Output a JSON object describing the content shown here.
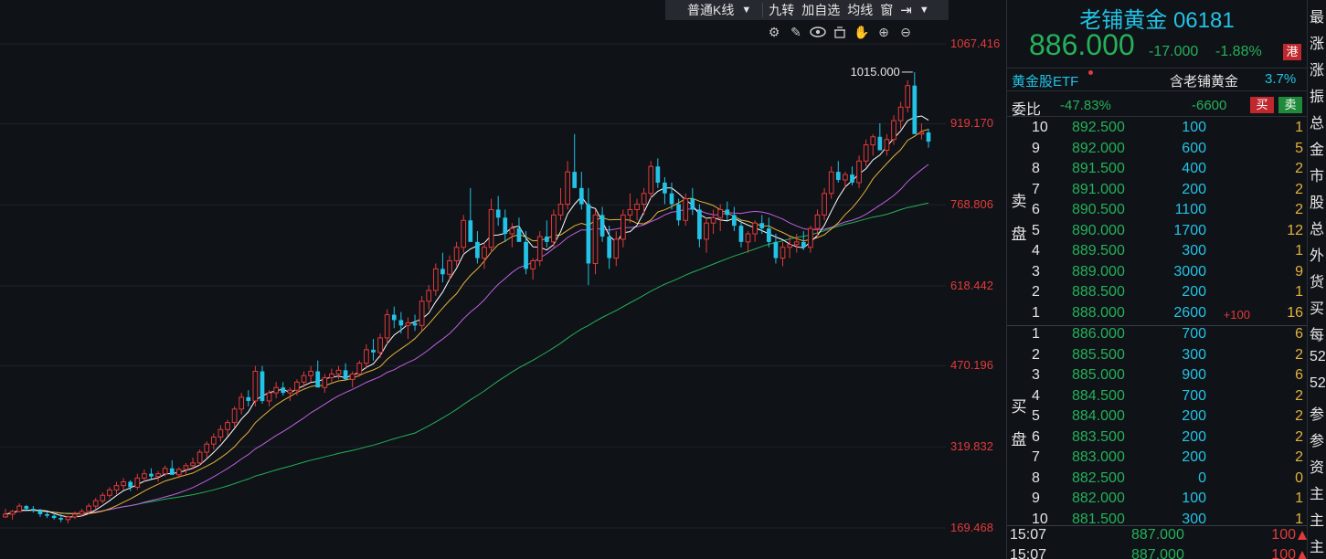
{
  "toolbar": {
    "chart_type": "普通K线",
    "items": [
      "九转",
      "加自选",
      "均线",
      "窗"
    ]
  },
  "chart_icons": [
    "settings-icon",
    "pen-icon",
    "eye-icon",
    "basket-icon",
    "hand-icon",
    "zoom-in-icon",
    "zoom-out-icon"
  ],
  "chart_data": {
    "type": "candlestick",
    "y_ticks": [
      "1067.416",
      "919.170",
      "768.806",
      "618.442",
      "470.196",
      "319.832",
      "169.468"
    ],
    "peak_label": "1015.000",
    "colors": {
      "up": "#e23b3b",
      "down": "#22c3e6",
      "ma5": "#ffffff",
      "ma10": "#e6b23b",
      "ma20": "#c060e0",
      "ma60": "#25b15a"
    },
    "candles": [
      [
        190,
        205,
        188,
        195
      ],
      [
        195,
        203,
        185,
        200
      ],
      [
        200,
        215,
        198,
        210
      ],
      [
        210,
        212,
        200,
        205
      ],
      [
        205,
        210,
        198,
        202
      ],
      [
        202,
        205,
        190,
        195
      ],
      [
        195,
        200,
        188,
        192
      ],
      [
        192,
        198,
        185,
        188
      ],
      [
        188,
        195,
        180,
        185
      ],
      [
        185,
        192,
        178,
        190
      ],
      [
        190,
        200,
        186,
        195
      ],
      [
        195,
        205,
        190,
        200
      ],
      [
        200,
        215,
        195,
        210
      ],
      [
        210,
        225,
        205,
        220
      ],
      [
        220,
        235,
        215,
        230
      ],
      [
        230,
        245,
        225,
        240
      ],
      [
        240,
        255,
        232,
        248
      ],
      [
        248,
        262,
        240,
        255
      ],
      [
        255,
        258,
        238,
        245
      ],
      [
        245,
        270,
        240,
        262
      ],
      [
        262,
        278,
        255,
        270
      ],
      [
        270,
        280,
        260,
        265
      ],
      [
        265,
        275,
        255,
        270
      ],
      [
        270,
        285,
        265,
        280
      ],
      [
        280,
        295,
        270,
        268
      ],
      [
        268,
        282,
        262,
        278
      ],
      [
        278,
        290,
        270,
        285
      ],
      [
        285,
        300,
        278,
        290
      ],
      [
        290,
        315,
        285,
        310
      ],
      [
        310,
        330,
        300,
        325
      ],
      [
        325,
        345,
        315,
        338
      ],
      [
        338,
        360,
        330,
        352
      ],
      [
        352,
        370,
        340,
        365
      ],
      [
        365,
        395,
        355,
        390
      ],
      [
        390,
        420,
        380,
        412
      ],
      [
        412,
        425,
        395,
        405
      ],
      [
        405,
        470,
        395,
        460
      ],
      [
        460,
        470,
        400,
        405
      ],
      [
        405,
        425,
        395,
        420
      ],
      [
        420,
        440,
        410,
        430
      ],
      [
        430,
        440,
        415,
        420
      ],
      [
        420,
        430,
        405,
        425
      ],
      [
        425,
        445,
        415,
        440
      ],
      [
        440,
        460,
        430,
        452
      ],
      [
        452,
        470,
        440,
        460
      ],
      [
        460,
        480,
        445,
        430
      ],
      [
        430,
        455,
        420,
        448
      ],
      [
        448,
        465,
        440,
        455
      ],
      [
        455,
        470,
        445,
        462
      ],
      [
        462,
        475,
        450,
        445
      ],
      [
        445,
        460,
        430,
        455
      ],
      [
        455,
        480,
        450,
        475
      ],
      [
        475,
        510,
        465,
        500
      ],
      [
        500,
        520,
        480,
        495
      ],
      [
        495,
        530,
        485,
        522
      ],
      [
        522,
        575,
        510,
        565
      ],
      [
        565,
        580,
        540,
        555
      ],
      [
        555,
        570,
        530,
        545
      ],
      [
        545,
        560,
        520,
        550
      ],
      [
        550,
        565,
        535,
        545
      ],
      [
        545,
        600,
        535,
        590
      ],
      [
        590,
        620,
        575,
        610
      ],
      [
        610,
        660,
        600,
        650
      ],
      [
        650,
        680,
        625,
        640
      ],
      [
        640,
        675,
        630,
        665
      ],
      [
        665,
        700,
        655,
        690
      ],
      [
        690,
        750,
        680,
        740
      ],
      [
        740,
        800,
        720,
        700
      ],
      [
        700,
        720,
        660,
        670
      ],
      [
        670,
        700,
        650,
        690
      ],
      [
        690,
        780,
        680,
        760
      ],
      [
        760,
        785,
        730,
        745
      ],
      [
        745,
        760,
        700,
        715
      ],
      [
        715,
        735,
        690,
        725
      ],
      [
        725,
        745,
        700,
        700
      ],
      [
        700,
        720,
        640,
        650
      ],
      [
        650,
        670,
        630,
        665
      ],
      [
        665,
        720,
        655,
        710
      ],
      [
        710,
        740,
        690,
        700
      ],
      [
        700,
        760,
        690,
        750
      ],
      [
        750,
        800,
        740,
        770
      ],
      [
        770,
        850,
        760,
        830
      ],
      [
        830,
        900,
        815,
        800
      ],
      [
        800,
        830,
        760,
        770
      ],
      [
        770,
        800,
        620,
        660
      ],
      [
        660,
        760,
        640,
        750
      ],
      [
        750,
        765,
        700,
        710
      ],
      [
        710,
        730,
        650,
        670
      ],
      [
        670,
        720,
        655,
        705
      ],
      [
        705,
        760,
        690,
        750
      ],
      [
        750,
        790,
        735,
        760
      ],
      [
        760,
        780,
        740,
        770
      ],
      [
        770,
        800,
        750,
        790
      ],
      [
        790,
        850,
        780,
        840
      ],
      [
        840,
        855,
        800,
        810
      ],
      [
        810,
        820,
        770,
        790
      ],
      [
        790,
        810,
        760,
        770
      ],
      [
        770,
        780,
        730,
        740
      ],
      [
        740,
        790,
        730,
        780
      ],
      [
        780,
        800,
        750,
        760
      ],
      [
        760,
        770,
        690,
        705
      ],
      [
        705,
        745,
        680,
        735
      ],
      [
        735,
        760,
        715,
        745
      ],
      [
        745,
        770,
        720,
        760
      ],
      [
        760,
        775,
        740,
        750
      ],
      [
        750,
        765,
        720,
        730
      ],
      [
        730,
        740,
        690,
        700
      ],
      [
        700,
        720,
        680,
        715
      ],
      [
        715,
        740,
        700,
        735
      ],
      [
        735,
        750,
        715,
        725
      ],
      [
        725,
        745,
        690,
        700
      ],
      [
        700,
        715,
        660,
        670
      ],
      [
        670,
        700,
        655,
        690
      ],
      [
        690,
        710,
        670,
        695
      ],
      [
        695,
        715,
        680,
        700
      ],
      [
        700,
        720,
        685,
        690
      ],
      [
        690,
        730,
        680,
        725
      ],
      [
        725,
        760,
        710,
        750
      ],
      [
        750,
        800,
        740,
        790
      ],
      [
        790,
        840,
        780,
        830
      ],
      [
        830,
        850,
        810,
        815
      ],
      [
        815,
        830,
        800,
        825
      ],
      [
        825,
        840,
        805,
        810
      ],
      [
        810,
        860,
        800,
        850
      ],
      [
        850,
        890,
        840,
        880
      ],
      [
        880,
        900,
        860,
        895
      ],
      [
        895,
        920,
        880,
        870
      ],
      [
        870,
        900,
        860,
        890
      ],
      [
        890,
        935,
        880,
        925
      ],
      [
        925,
        960,
        910,
        950
      ],
      [
        950,
        1000,
        940,
        990
      ],
      [
        990,
        1015,
        960,
        900
      ],
      [
        900,
        920,
        890,
        903
      ],
      [
        903,
        910,
        875,
        886
      ]
    ]
  },
  "quote": {
    "name": "老铺黄金",
    "code": "06181",
    "last": "886.000",
    "change": "-17.000",
    "change_pct": "-1.88%",
    "market_badge": "港"
  },
  "etf": {
    "name": "黄金股ETF",
    "holding_label": "含老铺黄金",
    "holding_pct": "3.7%"
  },
  "weibi": {
    "label": "委比",
    "pct": "-47.83%",
    "diff": "-6600",
    "buy_label": "买",
    "sell_label": "卖"
  },
  "ask_side_label": "卖盘",
  "bid_side_label": "买盘",
  "asks": [
    {
      "lvl": "10",
      "price": "892.500",
      "vol": "100",
      "delta": "",
      "cnt": "1"
    },
    {
      "lvl": "9",
      "price": "892.000",
      "vol": "600",
      "delta": "",
      "cnt": "5"
    },
    {
      "lvl": "8",
      "price": "891.500",
      "vol": "400",
      "delta": "",
      "cnt": "2"
    },
    {
      "lvl": "7",
      "price": "891.000",
      "vol": "200",
      "delta": "",
      "cnt": "2"
    },
    {
      "lvl": "6",
      "price": "890.500",
      "vol": "1100",
      "delta": "",
      "cnt": "2"
    },
    {
      "lvl": "5",
      "price": "890.000",
      "vol": "1700",
      "delta": "",
      "cnt": "12"
    },
    {
      "lvl": "4",
      "price": "889.500",
      "vol": "300",
      "delta": "",
      "cnt": "1"
    },
    {
      "lvl": "3",
      "price": "889.000",
      "vol": "3000",
      "delta": "",
      "cnt": "9"
    },
    {
      "lvl": "2",
      "price": "888.500",
      "vol": "200",
      "delta": "",
      "cnt": "1"
    },
    {
      "lvl": "1",
      "price": "888.000",
      "vol": "2600",
      "delta": "+100",
      "cnt": "16"
    }
  ],
  "bids": [
    {
      "lvl": "1",
      "price": "886.000",
      "vol": "700",
      "cnt": "6"
    },
    {
      "lvl": "2",
      "price": "885.500",
      "vol": "300",
      "cnt": "2"
    },
    {
      "lvl": "3",
      "price": "885.000",
      "vol": "900",
      "cnt": "6"
    },
    {
      "lvl": "4",
      "price": "884.500",
      "vol": "700",
      "cnt": "2"
    },
    {
      "lvl": "5",
      "price": "884.000",
      "vol": "200",
      "cnt": "2"
    },
    {
      "lvl": "6",
      "price": "883.500",
      "vol": "200",
      "cnt": "2"
    },
    {
      "lvl": "7",
      "price": "883.000",
      "vol": "200",
      "cnt": "2"
    },
    {
      "lvl": "8",
      "price": "882.500",
      "vol": "0",
      "cnt": "0"
    },
    {
      "lvl": "9",
      "price": "882.000",
      "vol": "100",
      "cnt": "1"
    },
    {
      "lvl": "10",
      "price": "881.500",
      "vol": "300",
      "cnt": "1"
    }
  ],
  "trades": [
    {
      "time": "15:07",
      "price": "887.000",
      "vol": "100"
    },
    {
      "time": "15:07",
      "price": "887.000",
      "vol": "100"
    }
  ],
  "stats_labels": [
    "最",
    "涨",
    "涨",
    "振",
    "总",
    "金",
    "市",
    "股",
    "总",
    "外",
    "货",
    "买",
    "每",
    "52",
    "52",
    "参",
    "参",
    "资",
    "主",
    "主",
    "主"
  ]
}
